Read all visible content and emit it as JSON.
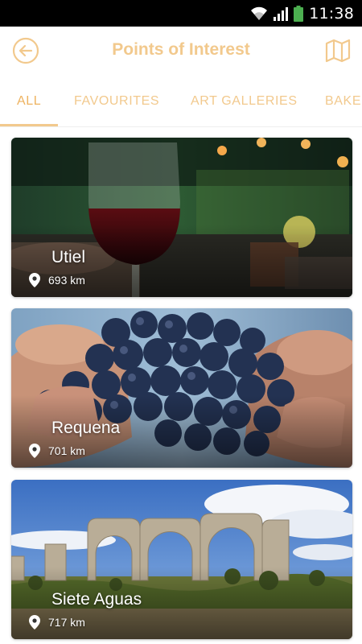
{
  "status_bar": {
    "time": "11:38",
    "icons": [
      "wifi-icon",
      "signal-icon",
      "battery-icon"
    ],
    "battery_color": "#4caf50"
  },
  "app_bar": {
    "title": "Points of Interest",
    "back_icon": "back-arrow-circle-icon",
    "map_icon": "map-icon",
    "accent_color": "#f2c98d"
  },
  "tabs": [
    {
      "label": "ALL",
      "active": true
    },
    {
      "label": "FAVOURITES",
      "active": false
    },
    {
      "label": "ART GALLERIES",
      "active": false
    },
    {
      "label": "BAKE",
      "active": false
    }
  ],
  "places": [
    {
      "name": "Utiel",
      "distance": "693 km",
      "icon": "location-pin-icon"
    },
    {
      "name": "Requena",
      "distance": "701 km",
      "icon": "location-pin-icon"
    },
    {
      "name": "Siete Aguas",
      "distance": "717 km",
      "icon": "location-pin-icon"
    }
  ]
}
